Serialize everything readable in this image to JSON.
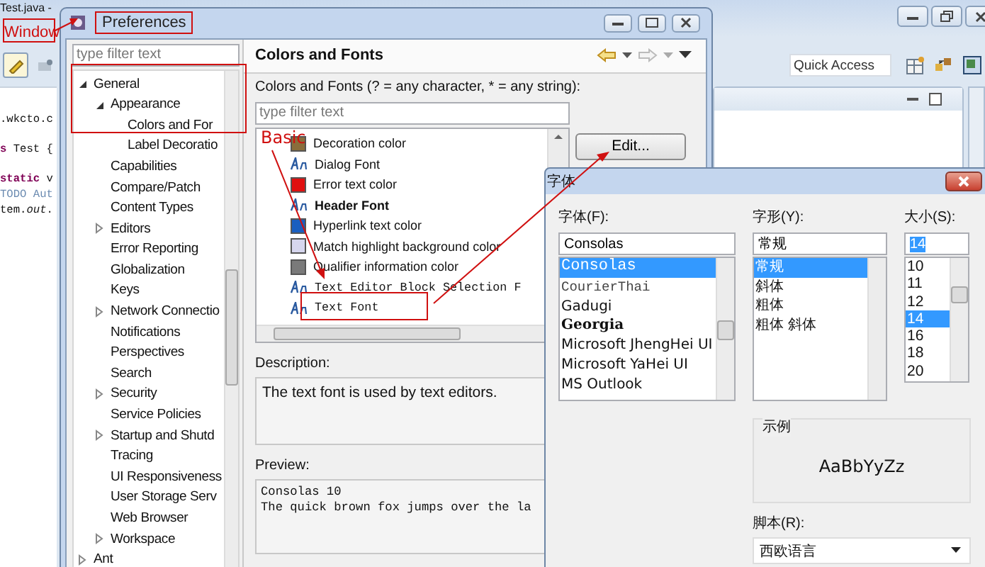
{
  "ide": {
    "title": "Test.java -",
    "menu": [
      "Window"
    ],
    "code_lines": [
      {
        "text": ".wkcto.c",
        "kind": "code"
      },
      {
        "text": "**s** Test {",
        "kind": "code"
      },
      {
        "text": "**static** v",
        "kind": "code"
      },
      {
        "text": "TODO Aut",
        "kind": "comment"
      },
      {
        "text": "tem.*out*.",
        "kind": "code"
      }
    ],
    "quick_access": {
      "placeholder": "Quick Access"
    }
  },
  "preferences": {
    "title": "Preferences",
    "filter": {
      "placeholder": "type filter text"
    },
    "tree": [
      {
        "label": "General",
        "expanded": true,
        "children": [
          {
            "label": "Appearance",
            "expanded": true,
            "children": [
              {
                "label": "Colors and For"
              },
              {
                "label": "Label Decoratio"
              }
            ]
          },
          {
            "label": "Capabilities"
          },
          {
            "label": "Compare/Patch"
          },
          {
            "label": "Content Types"
          },
          {
            "label": "Editors",
            "expanded": false
          },
          {
            "label": "Error Reporting"
          },
          {
            "label": "Globalization"
          },
          {
            "label": "Keys"
          },
          {
            "label": "Network Connectio",
            "expanded": false
          },
          {
            "label": "Notifications"
          },
          {
            "label": "Perspectives"
          },
          {
            "label": "Search"
          },
          {
            "label": "Security",
            "expanded": false
          },
          {
            "label": "Service Policies"
          },
          {
            "label": "Startup and Shutd",
            "expanded": false
          },
          {
            "label": "Tracing"
          },
          {
            "label": "UI Responsiveness"
          },
          {
            "label": "User Storage Serv"
          },
          {
            "label": "Web Browser"
          },
          {
            "label": "Workspace",
            "expanded": false
          }
        ]
      },
      {
        "label": "Ant",
        "expanded": false
      }
    ],
    "page": {
      "title": "Colors and Fonts",
      "filter_label": "Colors and Fonts (? = any character, * = any string):",
      "filter": {
        "placeholder": "type filter text"
      },
      "items": [
        {
          "label": "Decoration color",
          "kind": "color",
          "color": "#8a6d3b"
        },
        {
          "label": "Dialog Font",
          "kind": "font"
        },
        {
          "label": "Error text color",
          "kind": "color",
          "color": "#e01010"
        },
        {
          "label": "Header Font",
          "kind": "bold-font"
        },
        {
          "label": "Hyperlink text color",
          "kind": "color",
          "color": "#1a5fc0"
        },
        {
          "label": "Match highlight background color",
          "kind": "color",
          "color": "#d6d6ee"
        },
        {
          "label": "Qualifier information color",
          "kind": "color",
          "color": "#7a7a7a"
        },
        {
          "label": "Text Editor Block Selection F",
          "kind": "mono-font"
        },
        {
          "label": "Text Font",
          "kind": "mono-font"
        }
      ],
      "edit_button": "Edit...",
      "description_label": "Description:",
      "description": "The text font is used by text editors.",
      "preview_label": "Preview:",
      "preview_lines": [
        "Consolas 10",
        "The quick brown fox jumps over the la"
      ]
    }
  },
  "font_dialog": {
    "title": "字体",
    "font": {
      "label": "字体(F):",
      "value": "Consolas",
      "options": [
        {
          "label": "Consolas",
          "kind": "mono",
          "selected": true
        },
        {
          "label": "CourierThai",
          "kind": "courier",
          "selected": false
        },
        {
          "label": "Gadugi",
          "kind": "sans",
          "selected": false
        },
        {
          "label": "Georgia",
          "kind": "serif",
          "selected": false
        },
        {
          "label": "Microsoft JhengHei UI",
          "kind": "sans",
          "selected": false
        },
        {
          "label": "Microsoft YaHei UI",
          "kind": "sans",
          "selected": false
        },
        {
          "label": "MS Outlook",
          "kind": "sans",
          "selected": false
        }
      ]
    },
    "style": {
      "label": "字形(Y):",
      "value": "常规",
      "options": [
        {
          "label": "常规",
          "selected": true
        },
        {
          "label": "斜体",
          "selected": false
        },
        {
          "label": "粗体",
          "selected": false
        },
        {
          "label": "粗体 斜体",
          "selected": false
        }
      ]
    },
    "size": {
      "label": "大小(S):",
      "value": "14",
      "options": [
        {
          "label": "10",
          "selected": false
        },
        {
          "label": "11",
          "selected": false
        },
        {
          "label": "12",
          "selected": false
        },
        {
          "label": "14",
          "selected": true
        },
        {
          "label": "16",
          "selected": false
        },
        {
          "label": "18",
          "selected": false
        },
        {
          "label": "20",
          "selected": false
        }
      ]
    },
    "sample": {
      "label": "示例",
      "text": "AaBbYyZz"
    },
    "script": {
      "label": "脚本(R):",
      "value": "西欧语言"
    }
  },
  "annotation": {
    "label": "Basic"
  }
}
